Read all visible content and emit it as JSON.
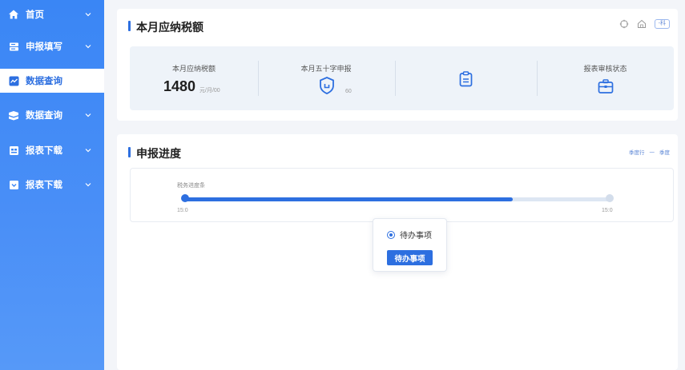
{
  "sidebar": {
    "items": [
      {
        "label": "首页",
        "icon": "home-icon",
        "chevron": true,
        "active": false
      },
      {
        "label": "申报填写",
        "icon": "form-icon",
        "chevron": true,
        "active": false
      },
      {
        "label": "数据查询",
        "icon": "chart-icon",
        "chevron": false,
        "active": true
      },
      {
        "label": "数据查询",
        "icon": "database-icon",
        "chevron": true,
        "active": false
      },
      {
        "label": "报表下载",
        "icon": "report-icon",
        "chevron": true,
        "active": false
      },
      {
        "label": "报表下载",
        "icon": "download-icon",
        "chevron": true,
        "active": false
      }
    ]
  },
  "tax_card": {
    "title": "本月应纳税额",
    "toolbar": {
      "refresh_icon": "refresh-icon",
      "home_icon": "home-outline-icon",
      "tag": "-科"
    },
    "stats": [
      {
        "label": "本月应纳税额",
        "value": "1480",
        "unit": "元/月/00"
      },
      {
        "label": "本月五十字申报",
        "icon": "shield-icon",
        "sub": "60"
      },
      {
        "label": "",
        "icon": "clipboard-icon"
      },
      {
        "label": "报表审核状态",
        "icon": "briefcase-icon"
      }
    ]
  },
  "progress_card": {
    "title": "申报进度",
    "links": [
      "季度行",
      "一",
      "季度"
    ],
    "progress": {
      "label": "税务进度条",
      "fraction": 0.77,
      "start": "15:0",
      "end": "15:0"
    }
  },
  "popup": {
    "radio_label": "待办事项",
    "button_label": "待办事项"
  },
  "colors": {
    "accent": "#2d6fe0",
    "sidebar": "#3a86f5"
  }
}
